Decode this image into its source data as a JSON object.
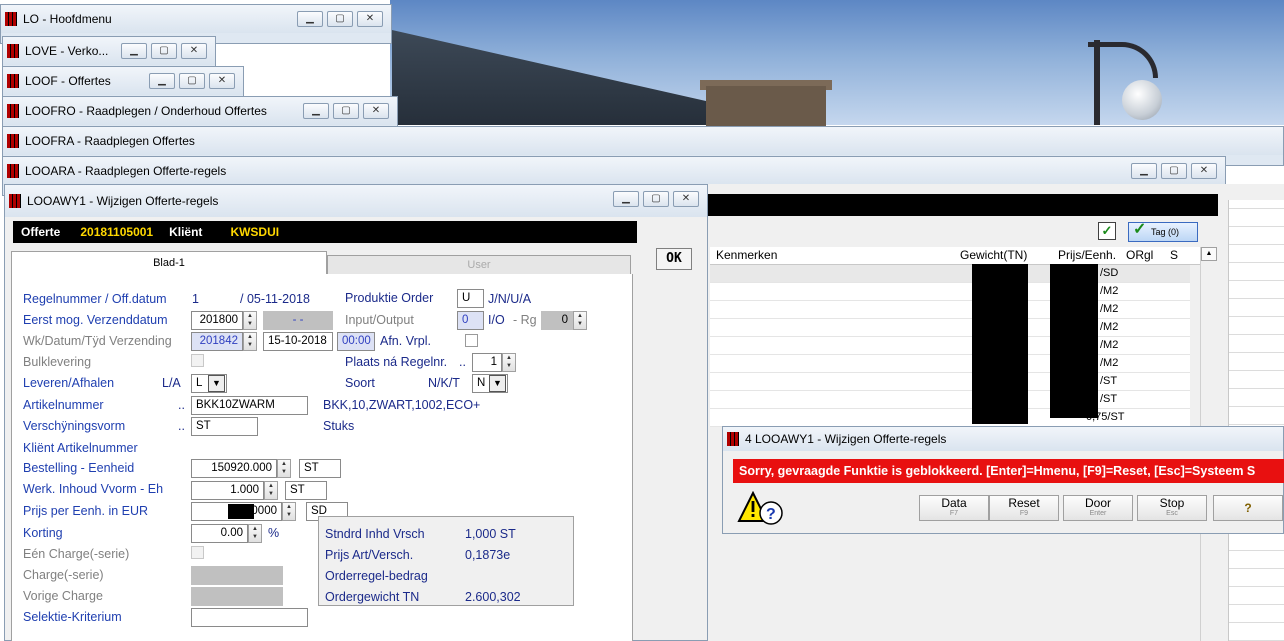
{
  "windows": {
    "w1": "LO - Hoofdmenu",
    "w2": "LOVE - Verko...",
    "w3": "LOOF - Offertes",
    "w4": "LOOFRO - Raadplegen / Onderhoud Offertes",
    "w5": "LOOFRA - Raadplegen Offertes",
    "w6": "LOOARA - Raadplegen Offerte-regels",
    "w7": "LOOAWY1 - Wijzigen Offerte-regels"
  },
  "header": {
    "offerte_label": "Offerte",
    "offerte_value": "20181105001",
    "klient_label": "Kliënt",
    "klient_value": "KWSDUI"
  },
  "tabs": {
    "tab1": "Blad-1",
    "tab2": "User"
  },
  "form": {
    "regelnummer_label": "Regelnummer / Off.datum",
    "regelnummer_value": "1",
    "offdatum_value": "/ 05-11-2018",
    "produktie_label": "Produktie Order",
    "produktie_value": "U",
    "produktie_options": "J/N/U/A",
    "eerst_label": "Eerst mog. Verzenddatum",
    "eerst_value": "201800",
    "eerst_extra": "- -",
    "inout_label": "Input/Output",
    "inout_value": "0",
    "io_label": "I/O",
    "rg_label": "- Rg",
    "rg_value": "0",
    "wk_label": "Wk/Datum/Tÿd Verzending",
    "wk_value": "201842",
    "datum_value": "15-10-2018",
    "tijd_value": "00:00",
    "afn_label": "Afn. Vrpl.",
    "bulk_label": "Bulklevering",
    "plaats_label": "Plaats ná Regelnr.",
    "plaats_dots": "..",
    "plaats_value": "1",
    "leveren_label": "Leveren/Afhalen",
    "leveren_opts": "L/A",
    "leveren_value": "L",
    "soort_label": "Soort",
    "soort_opts": "N/K/T",
    "soort_value": "N",
    "artikel_label": "Artikelnummer",
    "artikel_dots": "..",
    "artikel_value": "BKK10ZWARM",
    "artikel_desc": "BKK,10,ZWART,1002,ECO+",
    "vorm_label": "Verschÿningsvorm",
    "vorm_dots": "..",
    "vorm_value": "ST",
    "vorm_desc": "Stuks",
    "klient_art_label": "Kliënt Artikelnummer",
    "bestelling_label": "Bestelling - Eenheid",
    "bestelling_value": "150920.000",
    "bestelling_unit": "ST",
    "inhoud_label": "Werk. Inhoud Vvorm - Eh",
    "inhoud_value": "1.000",
    "inhoud_unit": "ST",
    "prijs_label": "Prijs per Eenh. in EUR",
    "prijs_value": "0000",
    "prijs_unit": "SD",
    "korting_label": "Korting",
    "korting_value": "0.00",
    "korting_unit": "%",
    "een_charge_label": "Eén Charge(-serie)",
    "charge_label": "Charge(-serie)",
    "vorige_label": "Vorige Charge",
    "selektie_label": "Selektie-Kriterium"
  },
  "info": {
    "stndrd_label": "Stndrd Inhd Vrsch",
    "stndrd_value": "1,000 ST",
    "prijsart_label": "Prijs Art/Versch.",
    "prijsart_value": "0,1873e",
    "orderregel_label": "Orderregel-bedrag",
    "ordergewicht_label": "Ordergewicht TN",
    "ordergewicht_value": "2.600,302"
  },
  "ok_label": "OK",
  "grid": {
    "tag_label": "Tag (0)",
    "headers": {
      "kenmerken": "Kenmerken",
      "gewicht": "Gewicht(TN)",
      "prijs": "Prijs/Eenh.",
      "orgl": "ORgl",
      "s": "S"
    },
    "rows": [
      "/SD",
      "/M2",
      "/M2",
      "/M2",
      "/M2",
      "/M2",
      "/ST",
      "/ST",
      "0,75/ST"
    ]
  },
  "popup": {
    "title": "4 LOOAWY1 - Wijzigen Offerte-regels",
    "message": "Sorry, gevraagde Funktie is geblokkeerd.  [Enter]=Hmenu, [F9]=Reset, [Esc]=Systeem S",
    "buttons": [
      {
        "label": "Data",
        "key": "F7"
      },
      {
        "label": "Reset",
        "key": "F9"
      },
      {
        "label": "Door",
        "key": "Enter"
      },
      {
        "label": "Stop",
        "key": "Esc"
      }
    ]
  },
  "colors": {
    "error": "#e81010",
    "label_blue": "#1f3fb0",
    "header_yellow": "#ffd800"
  }
}
